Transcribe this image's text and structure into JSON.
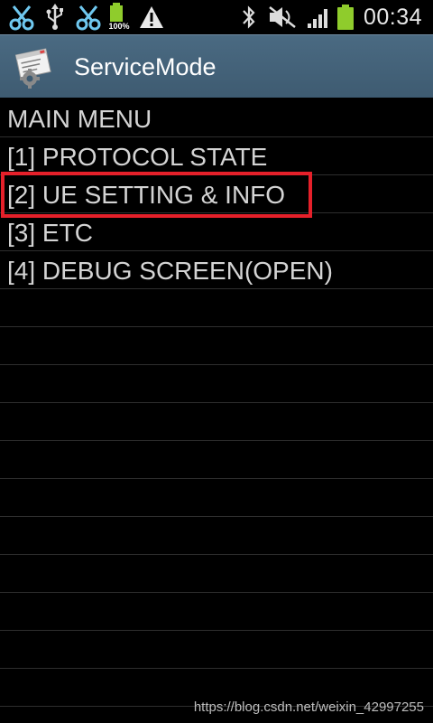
{
  "status_bar": {
    "time": "00:34",
    "battery_percent": "100%",
    "left_icons": [
      "scissors-icon",
      "usb-icon",
      "scissors-icon",
      "battery-full-icon",
      "warning-icon"
    ],
    "right_icons": [
      "bluetooth-icon",
      "mute-icon",
      "signal-icon",
      "battery-icon"
    ]
  },
  "title_bar": {
    "title": "ServiceMode",
    "icon": "service-mode-icon",
    "background": "#3e5b71"
  },
  "menu": {
    "rows": [
      "MAIN MENU",
      "[1] PROTOCOL STATE",
      "[2] UE SETTING & INFO",
      "[3] ETC",
      "[4] DEBUG SCREEN(OPEN)",
      "",
      "",
      "",
      "",
      "",
      "",
      "",
      "",
      "",
      "",
      ""
    ],
    "highlighted_row": 2,
    "highlight_color": "#e5202a"
  },
  "watermark": "https://blog.csdn.net/weixin_42997255"
}
